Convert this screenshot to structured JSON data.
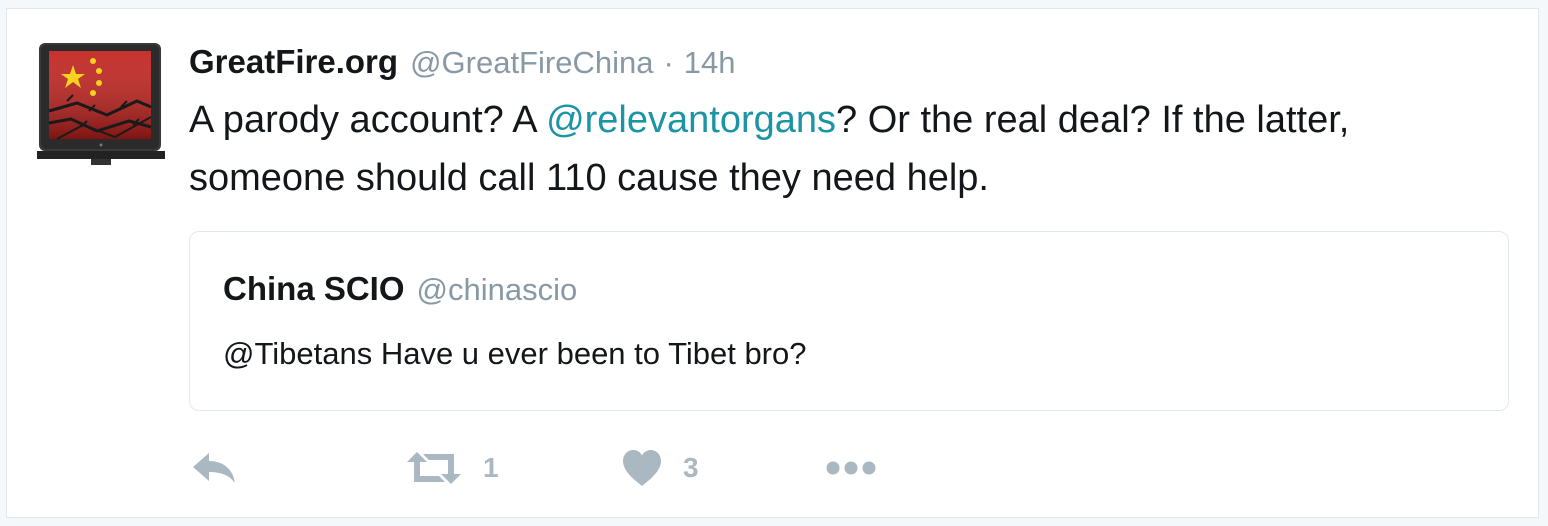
{
  "tweet": {
    "fullname": "GreatFire.org",
    "username": "@GreatFireChina",
    "separator": "·",
    "time": "14h",
    "text_part1": "A parody account? A ",
    "mention": "@relevantorgans",
    "text_part2": "? Or the real deal? If the latter, someone should call 110 cause they need help."
  },
  "quoted_tweet": {
    "fullname": "China SCIO",
    "username": "@chinascio",
    "text": "@Tibetans Have u ever been to Tibet bro?"
  },
  "actions": {
    "retweet_count": "1",
    "like_count": "3"
  },
  "icons": {
    "reply": "reply-icon",
    "retweet": "retweet-icon",
    "like": "heart-icon",
    "more": "more-icon"
  },
  "colors": {
    "link": "#1b95a5",
    "muted": "#8899a6",
    "action": "#aab8c2",
    "text": "#14171a",
    "border": "#e1e8ed"
  }
}
